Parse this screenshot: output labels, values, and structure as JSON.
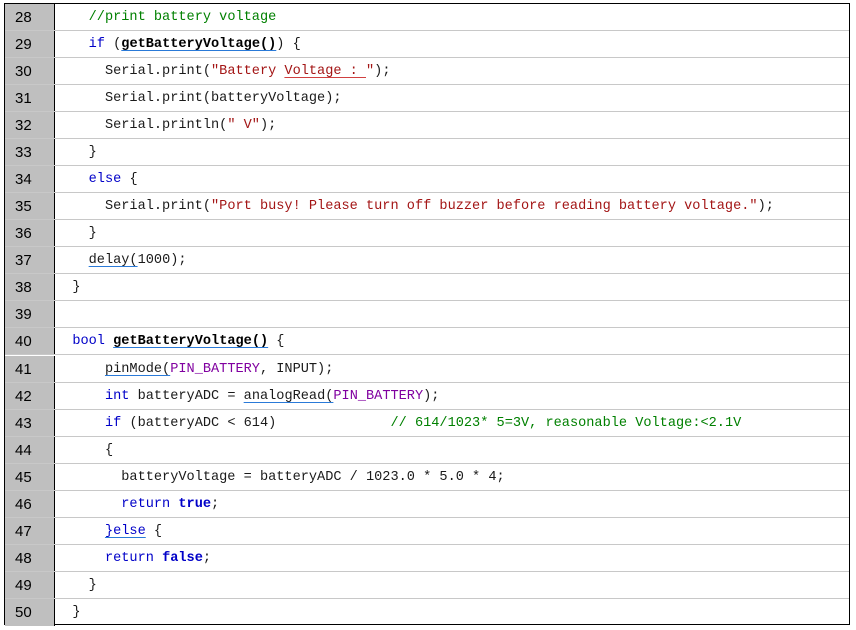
{
  "lines": [
    {
      "n": "28",
      "t": [
        {
          "s": "    "
        },
        {
          "s": "//print battery voltage",
          "c": "cmt"
        }
      ]
    },
    {
      "n": "29",
      "t": [
        {
          "s": "    "
        },
        {
          "s": "if",
          "c": "kw"
        },
        {
          "s": " ("
        },
        {
          "s": "getBatteryVoltage()",
          "c": "fn"
        },
        {
          "s": ") {"
        }
      ]
    },
    {
      "n": "30",
      "t": [
        {
          "s": "      Serial.print("
        },
        {
          "s": "\"Battery ",
          "c": "str"
        },
        {
          "s": "Voltage : ",
          "c": "str ulr"
        },
        {
          "s": "\"",
          "c": "str"
        },
        {
          "s": ");"
        }
      ]
    },
    {
      "n": "31",
      "t": [
        {
          "s": "      Serial.print(batteryVoltage);"
        }
      ]
    },
    {
      "n": "32",
      "t": [
        {
          "s": "      Serial.println("
        },
        {
          "s": "\" V\"",
          "c": "str"
        },
        {
          "s": ");"
        }
      ]
    },
    {
      "n": "33",
      "t": [
        {
          "s": "    }"
        }
      ]
    },
    {
      "n": "34",
      "t": [
        {
          "s": "    "
        },
        {
          "s": "else",
          "c": "kw"
        },
        {
          "s": " {"
        }
      ]
    },
    {
      "n": "35",
      "t": [
        {
          "s": "      Serial.print("
        },
        {
          "s": "\"Port busy! Please turn off buzzer before reading battery voltage.\"",
          "c": "str"
        },
        {
          "s": ");"
        }
      ]
    },
    {
      "n": "36",
      "t": [
        {
          "s": "    }"
        }
      ]
    },
    {
      "n": "37",
      "t": [
        {
          "s": "    "
        },
        {
          "s": "delay(",
          "c": "ul"
        },
        {
          "s": "1000);"
        }
      ]
    },
    {
      "n": "38",
      "t": [
        {
          "s": "  }"
        }
      ]
    },
    {
      "n": "39",
      "t": [
        {
          "s": ""
        }
      ]
    },
    {
      "n": "40",
      "t": [
        {
          "s": "  "
        },
        {
          "s": "bool",
          "c": "kw"
        },
        {
          "s": " "
        },
        {
          "s": "getBatteryVoltage()",
          "c": "fn"
        },
        {
          "s": " {"
        }
      ]
    },
    {
      "n": "41",
      "t": [
        {
          "s": "      "
        },
        {
          "s": "pinMode(",
          "c": "ul"
        },
        {
          "s": "PIN_BATTERY",
          "c": "const"
        },
        {
          "s": ", INPUT);"
        }
      ]
    },
    {
      "n": "42",
      "t": [
        {
          "s": "      "
        },
        {
          "s": "int",
          "c": "kw"
        },
        {
          "s": " batteryADC = "
        },
        {
          "s": "analogRead(",
          "c": "ul"
        },
        {
          "s": "PIN_BATTERY",
          "c": "const"
        },
        {
          "s": ");"
        }
      ]
    },
    {
      "n": "43",
      "t": [
        {
          "s": "      "
        },
        {
          "s": "if",
          "c": "kw"
        },
        {
          "s": " (batteryADC < 614)              "
        },
        {
          "s": "// 614/1023* 5=3V, reasonable Voltage:<2.1V",
          "c": "cmt"
        }
      ]
    },
    {
      "n": "44",
      "t": [
        {
          "s": "      {"
        }
      ]
    },
    {
      "n": "45",
      "t": [
        {
          "s": "        batteryVoltage = batteryADC / 1023.0 * 5.0 * 4;"
        }
      ]
    },
    {
      "n": "46",
      "t": [
        {
          "s": "        "
        },
        {
          "s": "return",
          "c": "kw"
        },
        {
          "s": " "
        },
        {
          "s": "true",
          "c": "kwb"
        },
        {
          "s": ";"
        }
      ]
    },
    {
      "n": "47",
      "t": [
        {
          "s": "      "
        },
        {
          "s": "}else",
          "c": "ul kw"
        },
        {
          "s": " {"
        }
      ]
    },
    {
      "n": "48",
      "t": [
        {
          "s": "      "
        },
        {
          "s": "return",
          "c": "kw"
        },
        {
          "s": " "
        },
        {
          "s": "false",
          "c": "kwb"
        },
        {
          "s": ";"
        }
      ]
    },
    {
      "n": "49",
      "t": [
        {
          "s": "    }"
        }
      ]
    },
    {
      "n": "50",
      "t": [
        {
          "s": "  }"
        }
      ]
    }
  ]
}
